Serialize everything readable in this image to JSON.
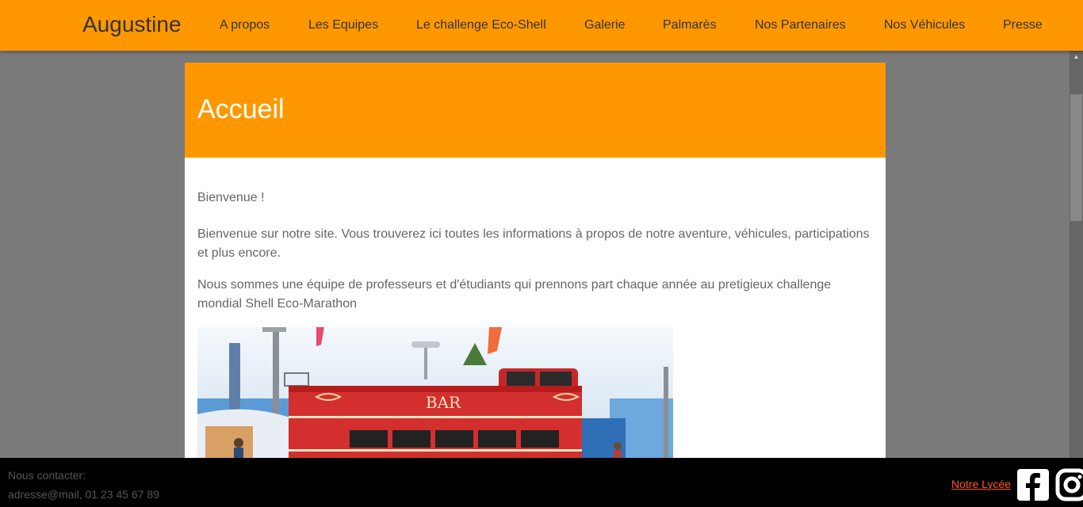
{
  "navbar": {
    "brand": "Augustine",
    "links": [
      "A propos",
      "Les Equipes",
      "Le challenge Eco-Shell",
      "Galerie",
      "Palmarès",
      "Nos Partenaires",
      "Nos Véhicules",
      "Presse"
    ]
  },
  "colors": {
    "accent": "#ff9800",
    "background": "#7a7a7a",
    "footer": "#000000",
    "link": "#ff5722"
  },
  "main": {
    "title": "Accueil",
    "welcome": "Bienvenue !",
    "intro": "Bienvenue sur notre site. Vous trouverez ici toutes les informations à propos de notre aventure, véhicules, participations et plus encore.",
    "team": "Nous sommes une équipe de professeurs et d'étudiants qui prennons part chaque année au pretigieux challenge mondial Shell Eco-Marathon",
    "photo_sign": "BAR"
  },
  "footer": {
    "contact_label": "Nous contacter:",
    "contact_info": "adresse@mail, 01 23 45 67 89",
    "school_link": "Notre Lycée",
    "icons": [
      "facebook-icon",
      "instagram-icon"
    ]
  }
}
